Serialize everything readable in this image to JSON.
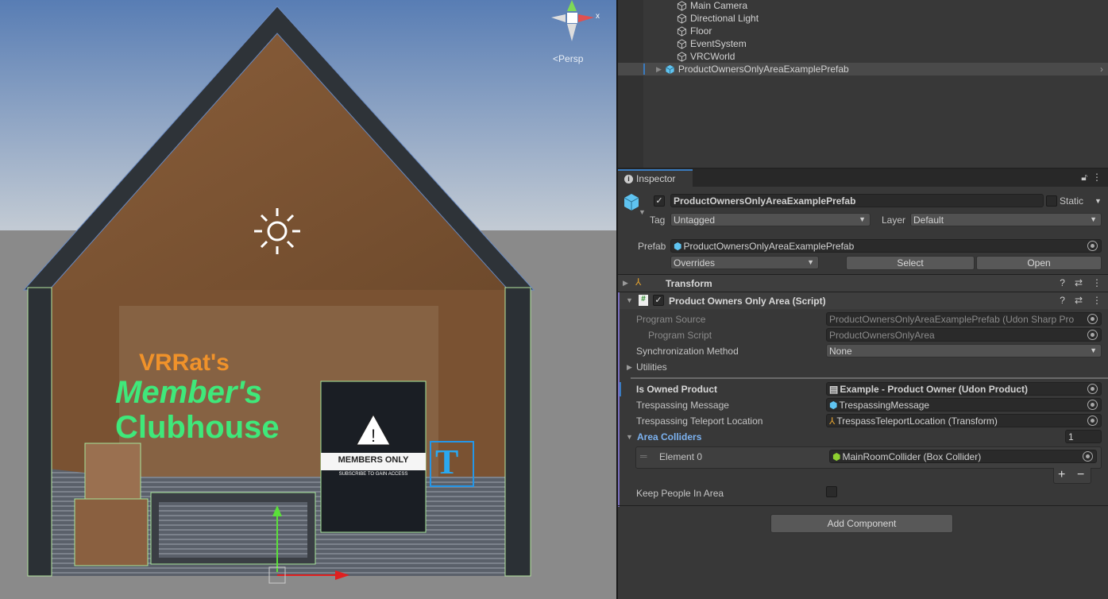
{
  "scene": {
    "persp_label": "Persp",
    "sign_title_1": "VRRat's",
    "sign_title_2": "Member's",
    "sign_title_3": "Clubhouse",
    "members_sign": "MEMBERS ONLY",
    "members_sub": "SUBSCRIBE TO GAIN ACCESS",
    "text_gizmo": "T",
    "gizmo_x_label": "x"
  },
  "hierarchy": {
    "items": [
      {
        "label": "Main Camera",
        "icon": "gameobject-icon"
      },
      {
        "label": "Directional Light",
        "icon": "gameobject-icon"
      },
      {
        "label": "Floor",
        "icon": "gameobject-icon"
      },
      {
        "label": "EventSystem",
        "icon": "gameobject-icon"
      },
      {
        "label": "VRCWorld",
        "icon": "gameobject-icon"
      },
      {
        "label": "ProductOwnersOnlyAreaExamplePrefab",
        "icon": "prefab-icon",
        "selected": true
      }
    ]
  },
  "inspector": {
    "tab_label": "Inspector",
    "object_name": "ProductOwnersOnlyAreaExamplePrefab",
    "static_label": "Static",
    "tag_label": "Tag",
    "tag_value": "Untagged",
    "layer_label": "Layer",
    "layer_value": "Default",
    "prefab_label": "Prefab",
    "prefab_value": "ProductOwnersOnlyAreaExamplePrefab",
    "overrides_value": "Overrides",
    "select_label": "Select",
    "open_label": "Open",
    "transform_title": "Transform",
    "script_title": "Product Owners Only Area (Script)",
    "fields": {
      "program_source_label": "Program Source",
      "program_source_value": "ProductOwnersOnlyAreaExamplePrefab (Udon Sharp Pro",
      "program_script_label": "Program Script",
      "program_script_value": "ProductOwnersOnlyArea",
      "sync_label": "Synchronization Method",
      "sync_value": "None",
      "utilities_label": "Utilities",
      "owned_label": "Is Owned Product",
      "owned_value": "Example - Product Owner (Udon Product)",
      "msg_label": "Trespassing Message",
      "msg_value": "TrespassingMessage",
      "tp_label": "Trespassing Teleport Location",
      "tp_value": "TrespassTeleportLocation (Transform)",
      "colliders_label": "Area Colliders",
      "colliders_count": "1",
      "element0_label": "Element 0",
      "element0_value": "MainRoomCollider (Box Collider)",
      "plus": "+",
      "minus": "−",
      "keep_label": "Keep People In Area"
    },
    "add_component_label": "Add Component"
  },
  "colors": {
    "accent": "#3a7bbf",
    "link": "#7cb2f0",
    "prefab": "#5fc3f0"
  }
}
